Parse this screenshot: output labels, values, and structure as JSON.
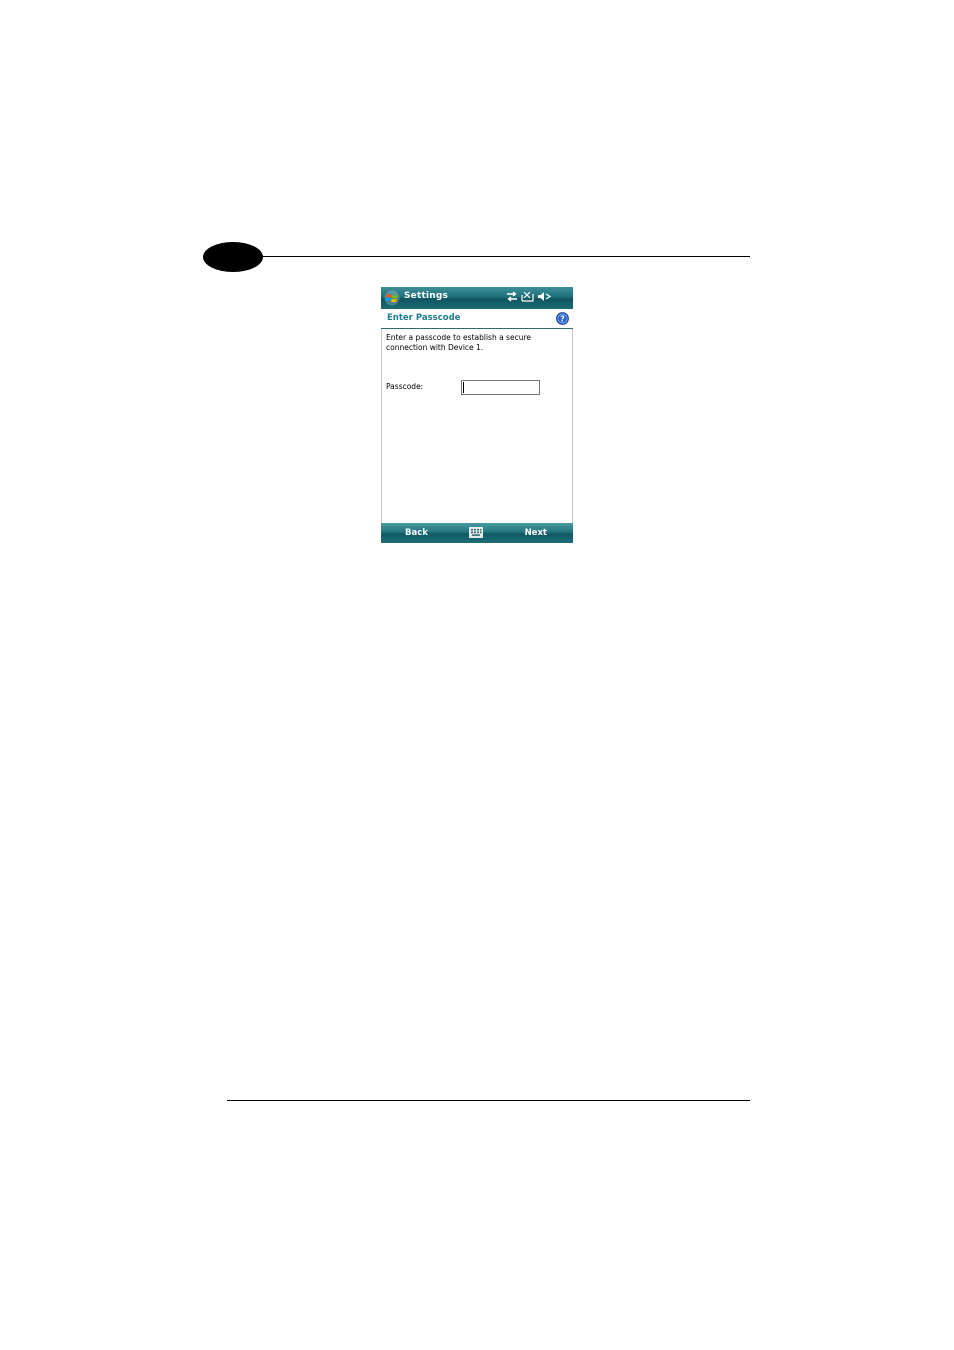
{
  "window": {
    "title": "Settings"
  },
  "page": {
    "heading": "Enter Passcode",
    "instructions": "Enter a passcode to establish a secure connection with Device 1."
  },
  "form": {
    "passcode_label": "Passcode:",
    "passcode_value": "",
    "passcode_placeholder": ""
  },
  "softkeys": {
    "left": "Back",
    "right": "Next"
  },
  "icons": {
    "start": "windows-start-icon",
    "connectivity": "connectivity-arrows-icon",
    "signal": "signal-off-icon",
    "volume": "volume-muted-icon",
    "help": "help-icon",
    "keyboard": "keyboard-icon"
  },
  "colors": {
    "titlebar": "#1f6f79",
    "heading": "#1a7f8c",
    "softbar": "#24747e"
  }
}
